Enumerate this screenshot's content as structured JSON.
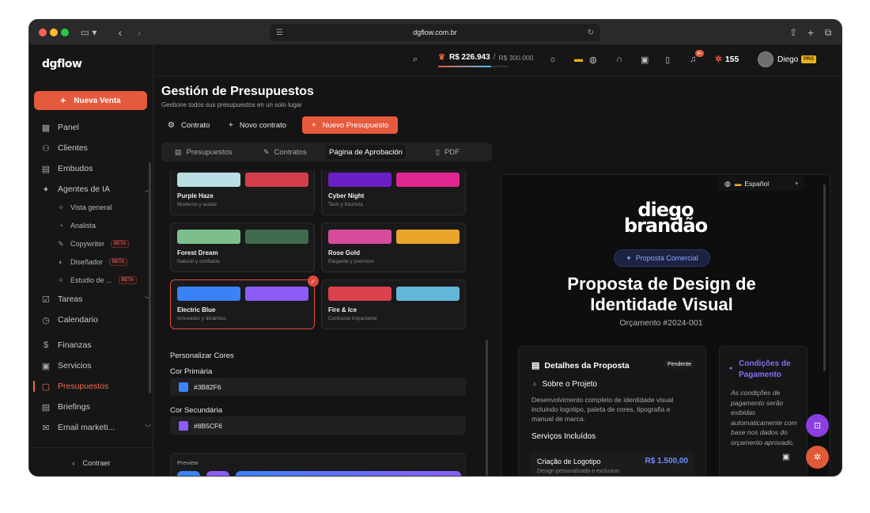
{
  "browser": {
    "url": "dgflow.com.br"
  },
  "sidebar": {
    "logo": "dgflow",
    "new_sale": "Nueva Venta",
    "items": [
      {
        "label": "Panel"
      },
      {
        "label": "Clientes"
      },
      {
        "label": "Embudos"
      },
      {
        "label": "Agentes de IA"
      },
      {
        "label": "Tareas"
      },
      {
        "label": "Calendario"
      },
      {
        "label": "Finanzas"
      },
      {
        "label": "Servicios"
      },
      {
        "label": "Presupuestos"
      },
      {
        "label": "Briefings"
      },
      {
        "label": "Email marketi..."
      }
    ],
    "sub_items": [
      {
        "label": "Vista general"
      },
      {
        "label": "Analista"
      },
      {
        "label": "Copywriter",
        "badge": "BETA"
      },
      {
        "label": "Diseñador",
        "badge": "BETA"
      },
      {
        "label": "Estudio de ...",
        "badge": "BETA"
      }
    ],
    "collapse": "Contraer"
  },
  "topbar": {
    "balance": "R$ 226.943",
    "goal": "R$ 300.000",
    "progress": 0.76,
    "notif_badge": "9+",
    "streak": "155",
    "user": "Diego",
    "plan": "PRO"
  },
  "page": {
    "title": "Gestión de Presupuestos",
    "subtitle": "Gestione todos sus presupuestos en un solo lugar",
    "buttons": {
      "contract": "Contrato",
      "new_contract": "Novo contrato",
      "new_budget": "Nuevo Presupuesto"
    },
    "tabs": [
      {
        "label": "Presupuestos"
      },
      {
        "label": "Contratos"
      },
      {
        "label": "Página de Aprobación"
      },
      {
        "label": "PDF"
      }
    ]
  },
  "themes": [
    {
      "name": "Purple Haze",
      "desc": "Moderno y audaz",
      "c1": "#b9dfe4",
      "c2": "#d23f4a"
    },
    {
      "name": "Cyber Night",
      "desc": "Tech y futurista",
      "c1": "#6a1fc4",
      "c2": "#e0278f"
    },
    {
      "name": "Forest Dream",
      "desc": "Natural y confiable",
      "c1": "#7dbf8c",
      "c2": "#3f6b4c"
    },
    {
      "name": "Rose Gold",
      "desc": "Elegante y premium",
      "c1": "#d64b9c",
      "c2": "#e9a52a"
    },
    {
      "name": "Electric Blue",
      "desc": "Innovador y dinámico",
      "c1": "#3b82f6",
      "c2": "#8b5cf6"
    },
    {
      "name": "Fire & Ice",
      "desc": "Contraste impactante",
      "c1": "#d9424a",
      "c2": "#62b7d8"
    }
  ],
  "customize": {
    "title": "Personalizar Cores",
    "primary_label": "Cor Primária",
    "primary_value": "#3B82F6",
    "secondary_label": "Cor Secundária",
    "secondary_value": "#8B5CF6",
    "preview_label": "Preview"
  },
  "proposal": {
    "language": "Español",
    "brand_line1": "diego",
    "brand_line2": "brandão",
    "tag": "Proposta Comercial",
    "title": "Proposta de Design de Identidade Visual",
    "budget_no": "Orçamento #2024-001",
    "details_title": "Detalhes da Proposta",
    "status": "Pendente",
    "about_title": "Sobre o Projeto",
    "about_text": "Desenvolvimento completo de identidade visual incluindo logotipo, paleta de cores, tipografia e manual de marca.",
    "services_title": "Serviços Incluídos",
    "service": {
      "name": "Criação de Logotipo",
      "price": "R$ 1.500,00",
      "desc": "Design personalizado e exclusivo"
    },
    "payment_title": "Condições de Pagamento",
    "payment_text": "As condições de pagamento serão exibidas automaticamente com base nos dados do orçamento aprovado."
  },
  "colors": {
    "accent": "#e55a3c",
    "primary": "#3b82f6",
    "secondary": "#8b5cf6"
  }
}
